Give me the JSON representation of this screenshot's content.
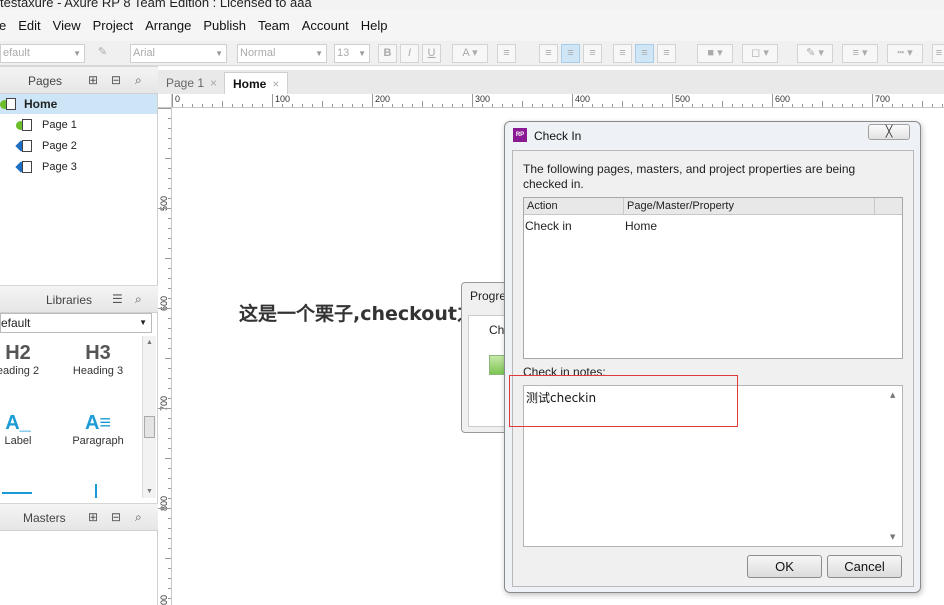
{
  "window": {
    "title": "testaxure - Axure RP 8 Team Edition : Licensed to aaa"
  },
  "menu": [
    "e",
    "Edit",
    "View",
    "Project",
    "Arrange",
    "Publish",
    "Team",
    "Account",
    "Help"
  ],
  "toolbar": {
    "style_combo": "efault",
    "font_combo": "Arial",
    "weight_combo": "Normal",
    "size_combo": "13",
    "bold": "B",
    "italic": "I",
    "underline": "U",
    "font_color": "A"
  },
  "pages_panel": {
    "title": "Pages",
    "items": [
      {
        "label": "Home",
        "selected": true
      },
      {
        "label": "Page 1"
      },
      {
        "label": "Page 2"
      },
      {
        "label": "Page 3"
      }
    ]
  },
  "libraries_panel": {
    "title": "Libraries",
    "selected_library": "efault",
    "items": [
      {
        "glyph": "H2",
        "label": "eading 2"
      },
      {
        "glyph": "H3",
        "label": "Heading 3"
      },
      {
        "glyph": "A_",
        "label": "Label"
      },
      {
        "glyph": "A≡",
        "label": "Paragraph"
      }
    ]
  },
  "masters_panel": {
    "title": "Masters"
  },
  "tabs": [
    {
      "label": "Page 1",
      "close": "×"
    },
    {
      "label": "Home",
      "close": "×",
      "active": true
    }
  ],
  "ruler": {
    "h_labels": [
      "0",
      "100",
      "200",
      "300",
      "400",
      "500",
      "600",
      "700"
    ],
    "v_labels": [
      "500",
      "600",
      "700",
      "800",
      "00"
    ]
  },
  "canvas": {
    "text": "这是一个栗子,checkout之"
  },
  "progress_dialog": {
    "title": "Progre",
    "label": "Ch"
  },
  "checkin_dialog": {
    "title": "Check In",
    "app_icon": "RP",
    "close": "╳",
    "description": "The following pages, masters, and project properties are being checked in.",
    "columns": [
      "Action",
      "Page/Master/Property"
    ],
    "rows": [
      {
        "action": "Check in",
        "item": "Home"
      }
    ],
    "notes_label": "Check in notes:",
    "notes_value": "测试checkin",
    "ok": "OK",
    "cancel": "Cancel"
  }
}
